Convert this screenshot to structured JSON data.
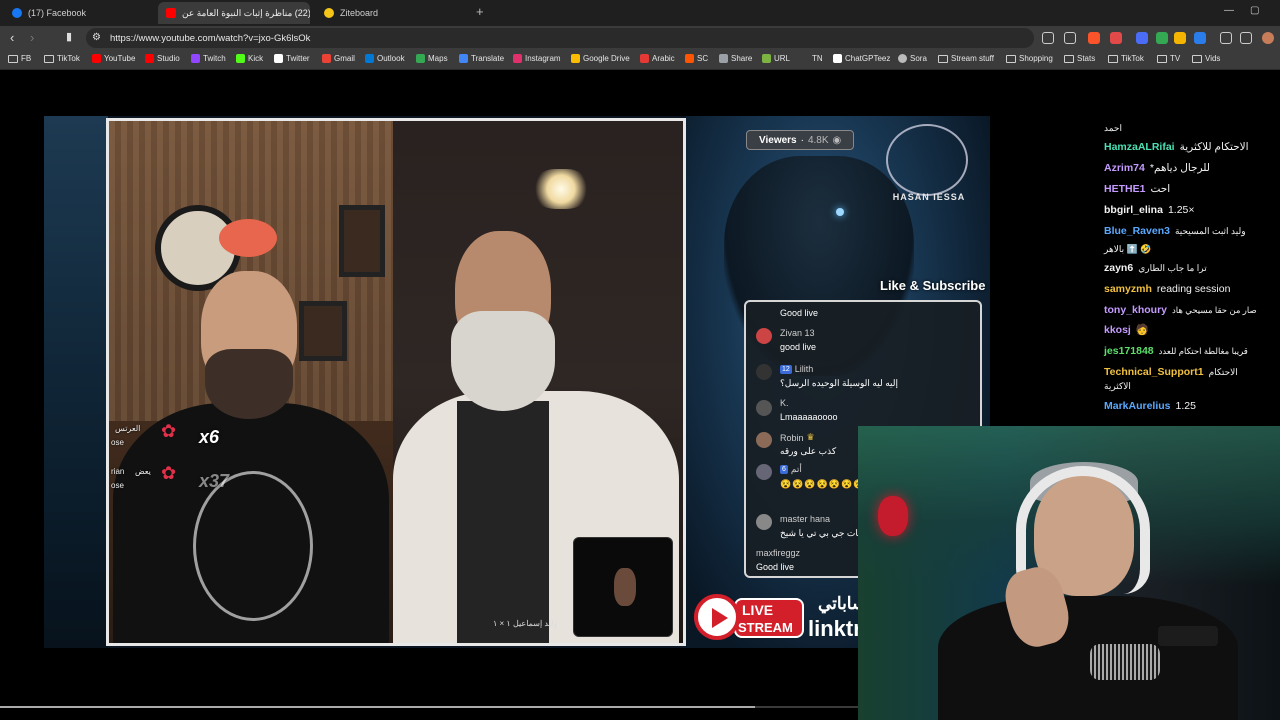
{
  "browser": {
    "tabs": [
      {
        "title": "(17) Facebook",
        "active": false,
        "favicon_color": "#1877f2"
      },
      {
        "title": "(22) مناظرة إثبات النبوة العامة عن",
        "active": true,
        "favicon_color": "#ff0000"
      },
      {
        "title": "Ziteboard",
        "active": false,
        "favicon_color": "#f5c518"
      }
    ],
    "new_tab": "+",
    "url": "https://www.youtube.com/watch?v=jxo-Gk6lsOk",
    "bookmarks": [
      {
        "label": "FB",
        "icon": "folder-icon"
      },
      {
        "label": "TikTok",
        "icon": "folder-icon"
      },
      {
        "label": "YouTube",
        "icon": "youtube-icon",
        "color": "#ff0000"
      },
      {
        "label": "Studio",
        "icon": "youtube-studio-icon",
        "color": "#ff0000"
      },
      {
        "label": "Twitch",
        "icon": "twitch-icon",
        "color": "#9146ff"
      },
      {
        "label": "Kick",
        "icon": "kick-icon",
        "color": "#53fc18"
      },
      {
        "label": "Twitter",
        "icon": "x-icon",
        "color": "#ffffff"
      },
      {
        "label": "Gmail",
        "icon": "gmail-icon",
        "color": "#ea4335"
      },
      {
        "label": "Outlook",
        "icon": "outlook-icon",
        "color": "#0078d4"
      },
      {
        "label": "Maps",
        "icon": "maps-icon",
        "color": "#34a853"
      },
      {
        "label": "Translate",
        "icon": "translate-icon",
        "color": "#4285f4"
      },
      {
        "label": "Instagram",
        "icon": "instagram-icon",
        "color": "#e1306c"
      },
      {
        "label": "Google Drive",
        "icon": "drive-icon",
        "color": "#fbbc04"
      },
      {
        "label": "Arabic",
        "icon": "arabic-icon",
        "color": "#e53935"
      },
      {
        "label": "SC",
        "icon": "sc-icon",
        "color": "#ff5500"
      },
      {
        "label": "Share",
        "icon": "share-icon",
        "color": "#9aa0a6"
      },
      {
        "label": "URL",
        "icon": "url-icon",
        "color": "#7cb342"
      },
      {
        "label": "TN",
        "icon": "tn-icon",
        "color": "#555555"
      },
      {
        "label": "ChatGPTeez",
        "icon": "chatgpt-icon",
        "color": "#ffffff"
      },
      {
        "label": "Sora",
        "icon": "sora-icon",
        "color": "#bbbbbb"
      },
      {
        "label": "Stream stuff",
        "icon": "folder-icon"
      },
      {
        "label": "Shopping",
        "icon": "folder-icon"
      },
      {
        "label": "Stats",
        "icon": "folder-icon"
      },
      {
        "label": "TikTok",
        "icon": "folder-icon"
      },
      {
        "label": "TV",
        "icon": "folder-icon"
      },
      {
        "label": "Vids",
        "icon": "folder-icon"
      }
    ]
  },
  "stream": {
    "viewers_label": "Viewers",
    "viewers_count": "4.8K",
    "channel_logo_text": "HASAN IESSA",
    "like_subscribe": "Like & Subscribe",
    "live_top": "LIVE",
    "live_bottom": "STREAM",
    "link_text": "linktr.e",
    "arabic_handle": "حساباتي",
    "cam_caption": "وليد إسماعيل ١ × ١",
    "gift_lines": [
      {
        "name": "العرتس",
        "sub": "ose",
        "multiplier": "x6"
      },
      {
        "name": "يعض",
        "prefix": "rian",
        "sub": "ose",
        "multiplier": "x37"
      }
    ],
    "overlay_chat": [
      {
        "name": "",
        "text": "Good live"
      },
      {
        "name": "Zivan 13",
        "text": "good live",
        "badge": ""
      },
      {
        "name": "Lilith",
        "text": "إليه ليه الوسيلة الوحيده الرسل؟",
        "badge": "12"
      },
      {
        "name": "K.",
        "text": "Lmaaaaaoooo",
        "badge": ""
      },
      {
        "name": "Robin",
        "text": "كذب على ورقه",
        "badge": ""
      },
      {
        "name": "أتم",
        "text": "😵😵😵😵😵😵😵😵😵😵😵😵",
        "badge": "6"
      },
      {
        "name": "master hana",
        "text": "شات جي بي تي يا شيخ",
        "badge": ""
      },
      {
        "name": "maxfireggz",
        "text": "Good live",
        "badge": ""
      }
    ]
  },
  "side_chat": [
    {
      "user": "",
      "color": "#ffffff",
      "message": "احمد"
    },
    {
      "user": "HamzaALRifai",
      "color": "#4ce0b3",
      "message": "الاحتكام للاكثرية"
    },
    {
      "user": "Azrim74",
      "color": "#c59bff",
      "message": "*للرجال دياهم"
    },
    {
      "user": "HETHE1",
      "color": "#c59bff",
      "message": "احت"
    },
    {
      "user": "bbgirl_elina",
      "color": "#f2f2f2",
      "message": "1.25×"
    },
    {
      "user": "Blue_Raven3",
      "color": "#5aa9ff",
      "message": "وليد اثبت المسيحية"
    },
    {
      "user": "",
      "color": "#ffffff",
      "message": "بالاهر ⬆️ 🤣"
    },
    {
      "user": "zayn6",
      "color": "#f2f2f2",
      "message": "ترا ما جاب الطاري"
    },
    {
      "user": "samyzmh",
      "color": "#f0c040",
      "message": "reading session"
    },
    {
      "user": "tony_khoury",
      "color": "#c59bff",
      "message": "صار من حقا مسيحي هاد"
    },
    {
      "user": "kkosj",
      "color": "#c59bff",
      "message": "🧑"
    },
    {
      "user": "jes171848",
      "color": "#5ce06a",
      "message": "قريبا مغالطة احتكام للعدد"
    },
    {
      "user": "Technical_Support1",
      "color": "#f0c040",
      "message": "الاحتكام"
    },
    {
      "user": "",
      "color": "#ffffff",
      "message": "الاكثرية"
    },
    {
      "user": "MarkAurelius",
      "color": "#5aa9ff",
      "message": "1.25"
    }
  ],
  "player": {
    "progress": 0.59
  },
  "colors": {
    "chrome_bg": "#3b3b3b",
    "tab_bg": "#1f1f1f",
    "live_red": "#d21f2a"
  }
}
